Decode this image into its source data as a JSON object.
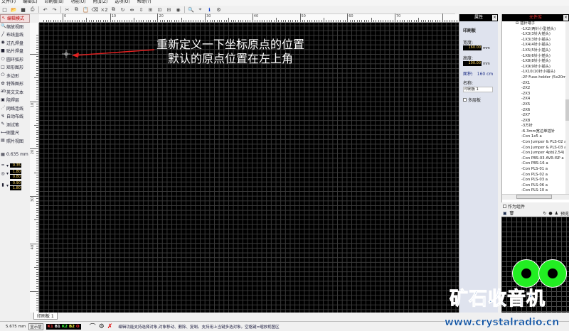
{
  "menu": [
    "文件(F)",
    "编辑(E)",
    "印刷板(B)",
    "功能(U)",
    "附加(Z)",
    "选项(O)",
    "帮助(?)"
  ],
  "toolbar": {
    "icons": [
      "new-icon",
      "open-icon",
      "save-icon",
      "print-icon",
      "undo-icon",
      "redo-icon",
      "cut-icon",
      "copy-icon",
      "paste-icon",
      "delete-icon",
      "duplicate-icon",
      "rotate-icon",
      "mirror-h-icon",
      "mirror-v-icon",
      "align-icon",
      "group-icon",
      "ungroup-icon",
      "mask-icon",
      "zoom-icon",
      "scanned-copy-icon",
      "info-icon",
      "settings-icon"
    ],
    "x2_label": "×2"
  },
  "left_tools": [
    {
      "label": "编辑模式",
      "icon": "pointer-icon",
      "active": true
    },
    {
      "label": "缩放视图",
      "icon": "magnifier-icon"
    },
    {
      "label": "布线直线",
      "icon": "track-icon"
    },
    {
      "label": "过孔焊盘",
      "icon": "via-pad-icon"
    },
    {
      "label": "贴片焊盘",
      "icon": "smd-pad-icon"
    },
    {
      "label": "圆环弧形",
      "icon": "circle-icon"
    },
    {
      "label": "矩形图形",
      "icon": "rectangle-icon"
    },
    {
      "label": "多边形",
      "icon": "polygon-icon"
    },
    {
      "label": "特殊图形",
      "icon": "special-shape-icon"
    },
    {
      "label": "英文文本",
      "icon": "text-icon"
    },
    {
      "label": "阻焊层",
      "icon": "solder-mask-icon"
    },
    {
      "label": "网络连线",
      "icon": "connection-icon"
    },
    {
      "label": "自动布线",
      "icon": "autoroute-icon"
    },
    {
      "label": "测试笔",
      "icon": "test-pen-icon"
    },
    {
      "label": "测量尺",
      "icon": "ruler-icon"
    },
    {
      "label": "照片视图",
      "icon": "photo-view-icon"
    }
  ],
  "grid": "0.635 mm",
  "track_width": "0.35",
  "pad_sizes": [
    "1.80",
    "0.80"
  ],
  "smd_sizes": [
    "0.90",
    "1.80"
  ],
  "ruler": {
    "h_labels": [
      "0",
      "10",
      "20",
      "30",
      "40",
      "50",
      "60",
      "70"
    ],
    "v_labels": [
      "10",
      "20",
      "30",
      "40"
    ]
  },
  "annotation": {
    "line1": "重新定义一下坐标原点的位置",
    "line2": "默认的原点位置在左上角",
    "arrow_color": "#e02020"
  },
  "properties": {
    "title": "属性",
    "section": "印刷板",
    "width_label": "宽度:",
    "width_value": "160.00",
    "height_label": "高度:",
    "height_value": "100.00",
    "unit": "mm",
    "area_label": "面积:",
    "area_value": "160 cm",
    "name_label": "名称:",
    "name_value": "印刷板 1",
    "multilayer_label": "多层板"
  },
  "components": {
    "title": "元件库",
    "root": "插针端子",
    "items": [
      "1X2(两针小型插头)",
      "1X3(3针大插头)",
      "1X3(3针小插头)",
      "1X4(4针小插头)",
      "1X5(5针小插头)",
      "1X6(6针小插头)",
      "1X8(8针小插头)",
      "1X9(9针小插头)",
      "1X10(10针小插头)",
      "2P Fuse-holder (5x20mm)",
      "2X1",
      "2X2",
      "2X3",
      "2X4",
      "2X5",
      "2X6",
      "2X7",
      "2X8",
      "3方针",
      "6.3mm宽边单插针",
      "Con 1x5 a",
      "Con Jumper & PLS-02 a",
      "Con Jumper & PLS-03 a",
      "Con Jumper 4pb(2,54) a",
      "Con PBS-03 AVR-ISP a",
      "Con PBS-16 a",
      "Con PLS-01 a",
      "Con PLS-02 a",
      "Con PLS-03 a",
      "Con PLS-06 a",
      "Con PLS-10 a"
    ],
    "as_component_label": "作为组件",
    "preview_label": "预览"
  },
  "tab": "印刷板 1",
  "status": {
    "coord_x": "5.675 mm",
    "layers_label": "显示层",
    "layers": [
      {
        "name": "K1",
        "color": "#ff4040"
      },
      {
        "name": "B1",
        "color": "#ffffff"
      },
      {
        "name": "K2",
        "color": "#40ff40"
      },
      {
        "name": "B2",
        "color": "#ffff40"
      },
      {
        "name": "O",
        "color": "#ff3030"
      }
    ],
    "hint": "编辑功能支持选择对象,对象移动、删除、复制。支持用上当键多选对象。空格键=缩放视图区"
  },
  "watermark": {
    "text": "矿石收音机",
    "url": "www.crystalradio.cn"
  }
}
